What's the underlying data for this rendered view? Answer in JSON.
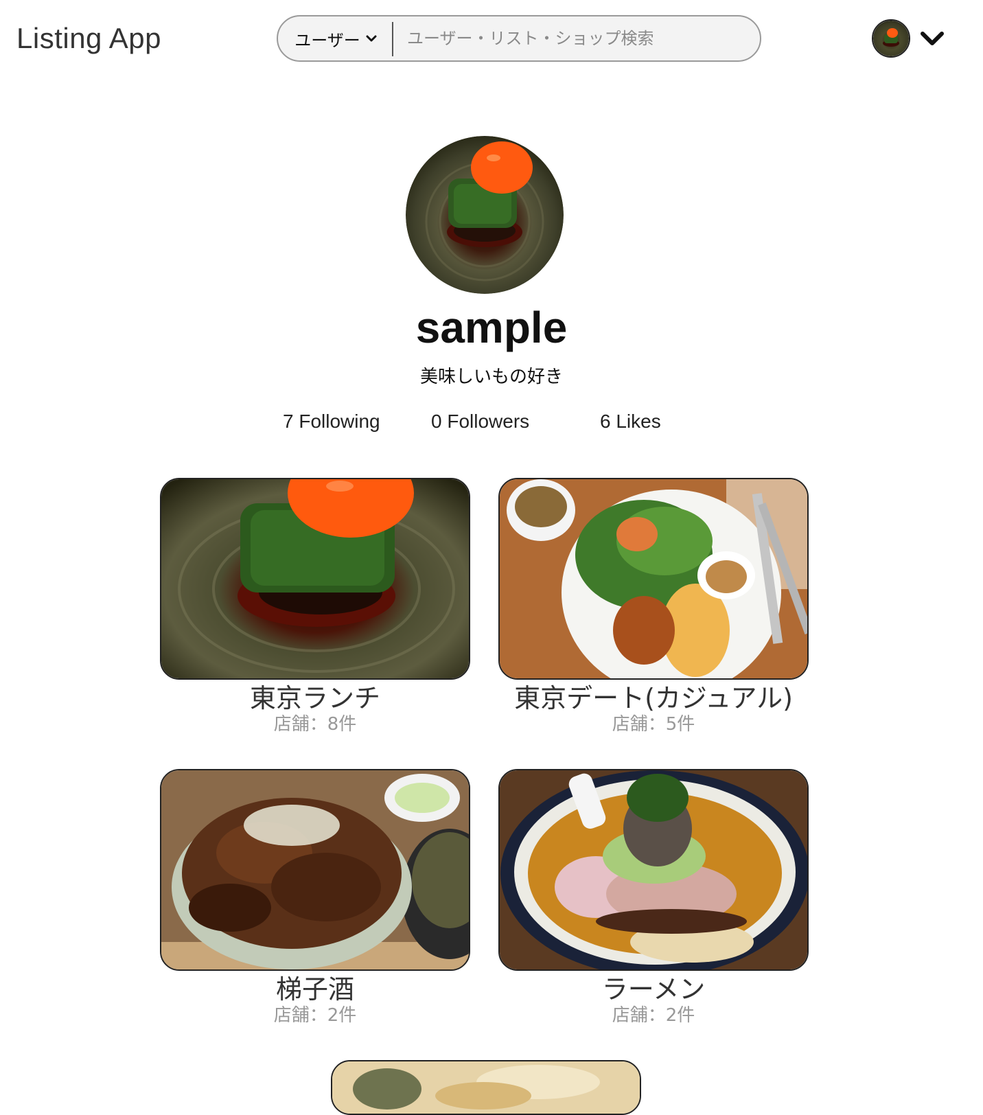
{
  "app": {
    "title": "Listing App"
  },
  "search": {
    "type_selected": "ユーザー",
    "placeholder": "ユーザー・リスト・ショップ検索"
  },
  "header": {
    "avatar_icon": "user-avatar",
    "menu_icon": "chevron-down-icon"
  },
  "profile": {
    "name": "sample",
    "bio": "美味しいもの好き"
  },
  "stats": {
    "following": "7 Following",
    "followers": "0 Followers",
    "likes": "6 Likes"
  },
  "lists": [
    {
      "title": "東京ランチ",
      "count": "店舗：8件",
      "image": "green-vegetable-with-egg-yolk"
    },
    {
      "title": "東京デート(カジュアル)",
      "count": "店舗：5件",
      "image": "salad-pancake-plate"
    },
    {
      "title": "梯子酒",
      "count": "店舗：2件",
      "image": "grilled-pork-rice-bowl"
    },
    {
      "title": "ラーメン",
      "count": "店舗：2件",
      "image": "ramen-bowl"
    }
  ]
}
